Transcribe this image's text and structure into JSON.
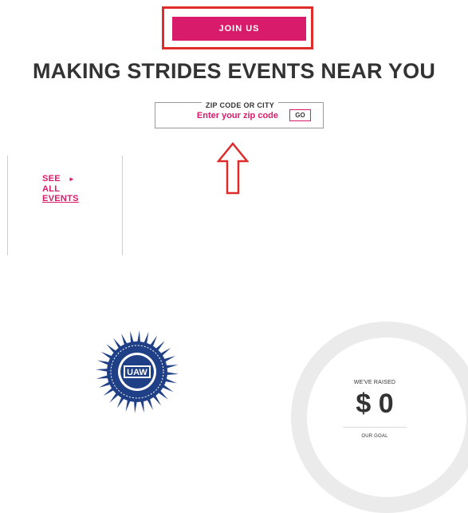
{
  "join": {
    "label": "JOIN US"
  },
  "headline": "MAKING STRIDES EVENTS NEAR YOU",
  "zip_search": {
    "legend": "ZIP CODE OR CITY",
    "placeholder": "Enter your zip code",
    "go_label": "GO"
  },
  "events": {
    "line1": "SEE",
    "line2": "ALL",
    "line3": "EVENTS",
    "arrow_icon": "triangle-right-icon"
  },
  "logo": {
    "text": "UAW",
    "icon": "uaw-seal-logo"
  },
  "fundraising": {
    "raised_label": "WE'VE RAISED",
    "raised_amount": "$ 0",
    "goal_label": "OUR GOAL"
  },
  "colors": {
    "brand_pink": "#d81b6a",
    "annotation_red": "#e02b2b",
    "ring_gray": "#ebebeb",
    "seal_blue": "#1f3f86"
  }
}
